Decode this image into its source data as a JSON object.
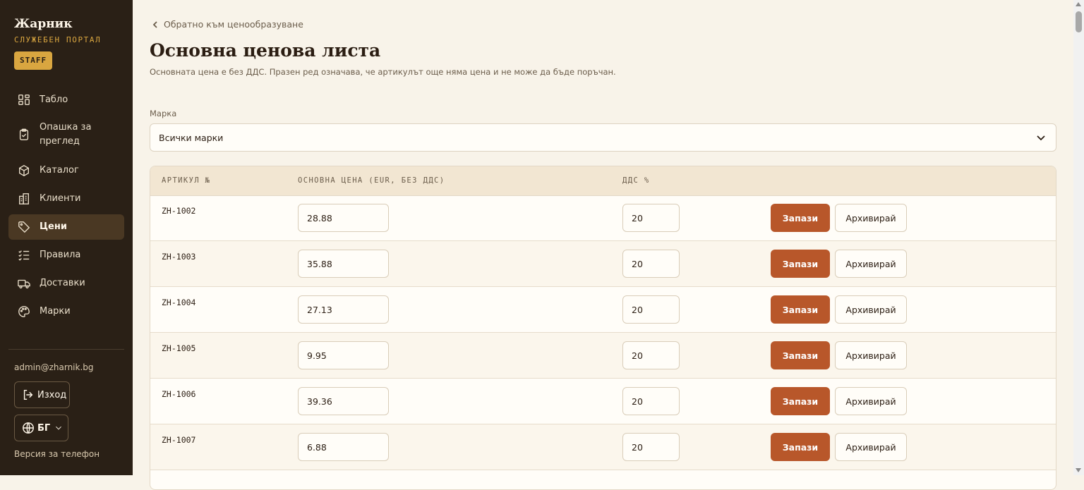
{
  "sidebar": {
    "brand": "Жарник",
    "portal": "СЛУЖЕБЕН ПОРТАЛ",
    "badge": "STAFF",
    "items": [
      {
        "label": "Табло",
        "icon": "dashboard-icon"
      },
      {
        "label": "Опашка за преглед",
        "icon": "clipboard-check-icon"
      },
      {
        "label": "Каталог",
        "icon": "box-icon"
      },
      {
        "label": "Клиенти",
        "icon": "building-icon"
      },
      {
        "label": "Цени",
        "icon": "tag-icon",
        "active": true
      },
      {
        "label": "Правила",
        "icon": "checklist-icon"
      },
      {
        "label": "Доставки",
        "icon": "truck-icon"
      },
      {
        "label": "Марки",
        "icon": "palette-icon"
      }
    ],
    "email": "admin@zharnik.bg",
    "logout": "Изход",
    "language": "БГ",
    "mobile_link": "Версия за телефон"
  },
  "main": {
    "back_link": "Обратно към ценообразуване",
    "title": "Основна ценова листа",
    "subtitle": "Основната цена е без ДДС. Празен ред означава, че артикулът още няма цена и не може да бъде поръчан.",
    "brand_filter": {
      "label": "Марка",
      "value": "Всички марки"
    },
    "table": {
      "headers": [
        "АРТИКУЛ №",
        "ОСНОВНА ЦЕНА (EUR, БЕЗ ДДС)",
        "ДДС %"
      ],
      "save_label": "Запази",
      "archive_label": "Архивирай",
      "rows": [
        {
          "sku": "ZH-1002",
          "price": "28.88",
          "vat": "20"
        },
        {
          "sku": "ZH-1003",
          "price": "35.88",
          "vat": "20"
        },
        {
          "sku": "ZH-1004",
          "price": "27.13",
          "vat": "20"
        },
        {
          "sku": "ZH-1005",
          "price": "9.95",
          "vat": "20"
        },
        {
          "sku": "ZH-1006",
          "price": "39.36",
          "vat": "20"
        },
        {
          "sku": "ZH-1007",
          "price": "6.88",
          "vat": "20"
        }
      ]
    }
  },
  "colors": {
    "sidebar_bg": "#2a2016",
    "accent": "#b8572a",
    "badge": "#d9a640",
    "page_bg": "#f8f3e9"
  }
}
